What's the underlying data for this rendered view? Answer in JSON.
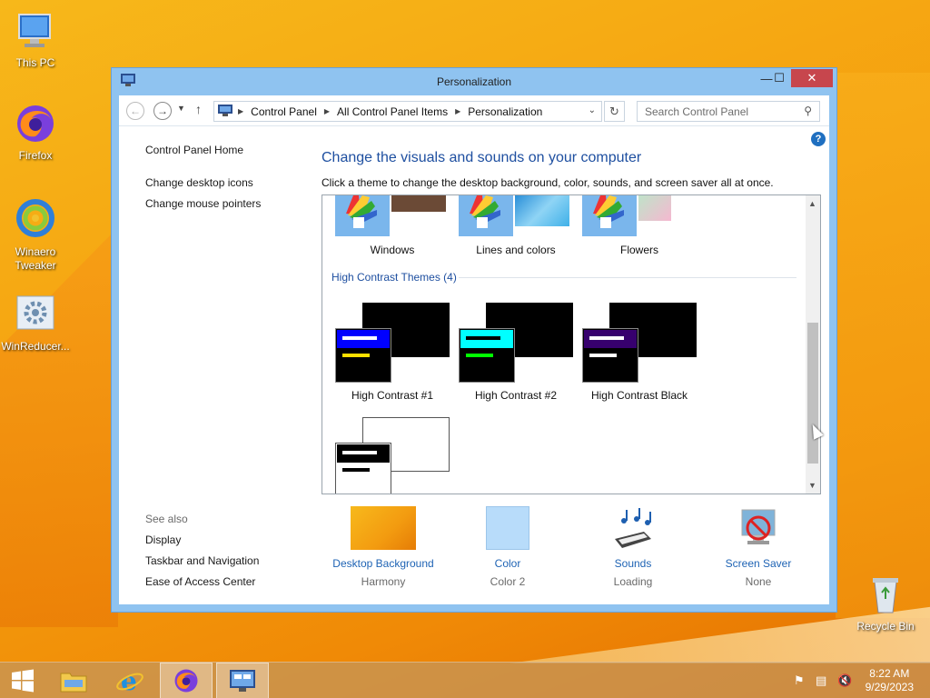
{
  "desktop": {
    "icons": [
      {
        "name": "this-pc-icon",
        "label": "This PC"
      },
      {
        "name": "firefox-icon",
        "label": "Firefox"
      },
      {
        "name": "winaero-tweaker-icon",
        "label": "Winaero\nTweaker"
      },
      {
        "name": "winreducer-icon",
        "label": "WinReducer..."
      },
      {
        "name": "recycle-bin-icon",
        "label": "Recycle Bin"
      }
    ]
  },
  "window": {
    "title": "Personalization",
    "controls": {
      "minimize": "—",
      "maximize": "☐",
      "close": "✕"
    }
  },
  "addressbar": {
    "crumbs": [
      "Control Panel",
      "All Control Panel Items",
      "Personalization"
    ],
    "search_placeholder": "Search Control Panel"
  },
  "sidebar": {
    "home": "Control Panel Home",
    "items": [
      "Change desktop icons",
      "Change mouse pointers"
    ]
  },
  "main": {
    "title": "Change the visuals and sounds on your computer",
    "subtitle": "Click a theme to change the desktop background, color, sounds, and screen saver all at once."
  },
  "themes": {
    "top_row": [
      "Windows",
      "Lines and colors",
      "Flowers"
    ],
    "high_contrast_header": "High Contrast Themes (4)",
    "high_contrast": [
      {
        "label": "High Contrast #1",
        "accent": "#0000ff",
        "bar": "#ffe000"
      },
      {
        "label": "High Contrast #2",
        "accent": "#00ffff",
        "bar": "#00ff00"
      },
      {
        "label": "High Contrast Black",
        "accent": "#37006e",
        "bar": "#ffffff"
      }
    ]
  },
  "see_also": {
    "header": "See also",
    "items": [
      "Display",
      "Taskbar and Navigation",
      "Ease of Access Center"
    ]
  },
  "bottom": [
    {
      "link": "Desktop Background",
      "sub": "Harmony"
    },
    {
      "link": "Color",
      "sub": "Color 2"
    },
    {
      "link": "Sounds",
      "sub": "Loading"
    },
    {
      "link": "Screen Saver",
      "sub": "None"
    }
  ],
  "taskbar": {
    "time": "8:22 AM",
    "date": "9/29/2023"
  }
}
